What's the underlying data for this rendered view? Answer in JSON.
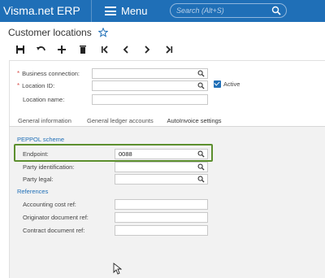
{
  "app": {
    "title": "Visma.net ERP",
    "menu_label": "Menu",
    "search_placeholder": "Search (Alt+S)"
  },
  "page": {
    "title": "Customer locations"
  },
  "header_fields": {
    "business_connection": {
      "label": "Business connection:",
      "value": ""
    },
    "location_id": {
      "label": "Location ID:",
      "value": ""
    },
    "location_name": {
      "label": "Location name:",
      "value": ""
    },
    "active": {
      "label": "Active",
      "checked": true
    }
  },
  "tabs": [
    {
      "label": "General information"
    },
    {
      "label": "General ledger accounts"
    },
    {
      "label": "AutoInvoice settings"
    }
  ],
  "peppol": {
    "section": "PEPPOL scheme",
    "endpoint": {
      "label": "Endpoint:",
      "value": "0088"
    },
    "party_identification": {
      "label": "Party identification:",
      "value": ""
    },
    "party_legal": {
      "label": "Party legal:",
      "value": ""
    }
  },
  "references": {
    "section": "References",
    "accounting_cost_ref": {
      "label": "Accounting cost ref:",
      "value": ""
    },
    "originator_document_ref": {
      "label": "Originator document ref:",
      "value": ""
    },
    "contract_document_ref": {
      "label": "Contract document ref:",
      "value": ""
    }
  },
  "colors": {
    "brand_blue": "#1f6fb7",
    "highlight_green": "#5c8f2e",
    "required_red": "#d9534f"
  }
}
